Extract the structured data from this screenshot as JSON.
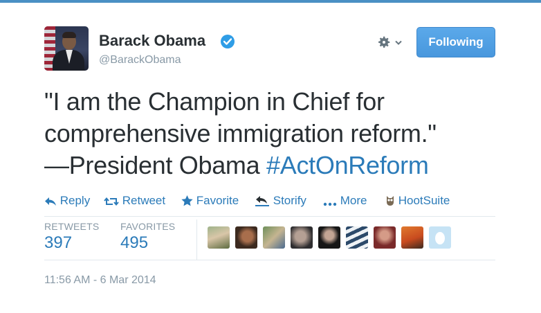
{
  "author": {
    "name": "Barack Obama",
    "handle": "@BarackObama",
    "verified": true
  },
  "follow_button": {
    "label": "Following"
  },
  "tweet": {
    "line1": "\"I am the Champion in Chief for",
    "line2": "comprehensive immigration reform.\"",
    "line3": "—President Obama ",
    "hashtag": "#ActOnReform"
  },
  "actions": {
    "reply": "Reply",
    "retweet": "Retweet",
    "favorite": "Favorite",
    "storify": "Storify",
    "more": "More",
    "hootsuite": "HootSuite"
  },
  "stats": {
    "retweets_label": "RETWEETS",
    "retweets_value": "397",
    "favorites_label": "FAVORITES",
    "favorites_value": "495"
  },
  "favoriters": [
    {
      "name": "favoriter-1"
    },
    {
      "name": "favoriter-2"
    },
    {
      "name": "favoriter-3"
    },
    {
      "name": "favoriter-4"
    },
    {
      "name": "favoriter-5"
    },
    {
      "name": "favoriter-6"
    },
    {
      "name": "favoriter-7"
    },
    {
      "name": "favoriter-8"
    },
    {
      "name": "favoriter-9"
    }
  ],
  "timestamp": "11:56 AM - 6 Mar 2014",
  "colors": {
    "link": "#2b7bb9",
    "muted": "#8899a6",
    "text": "#292f33",
    "follow_button": "#4897dd",
    "verified": "#2f9de6"
  }
}
